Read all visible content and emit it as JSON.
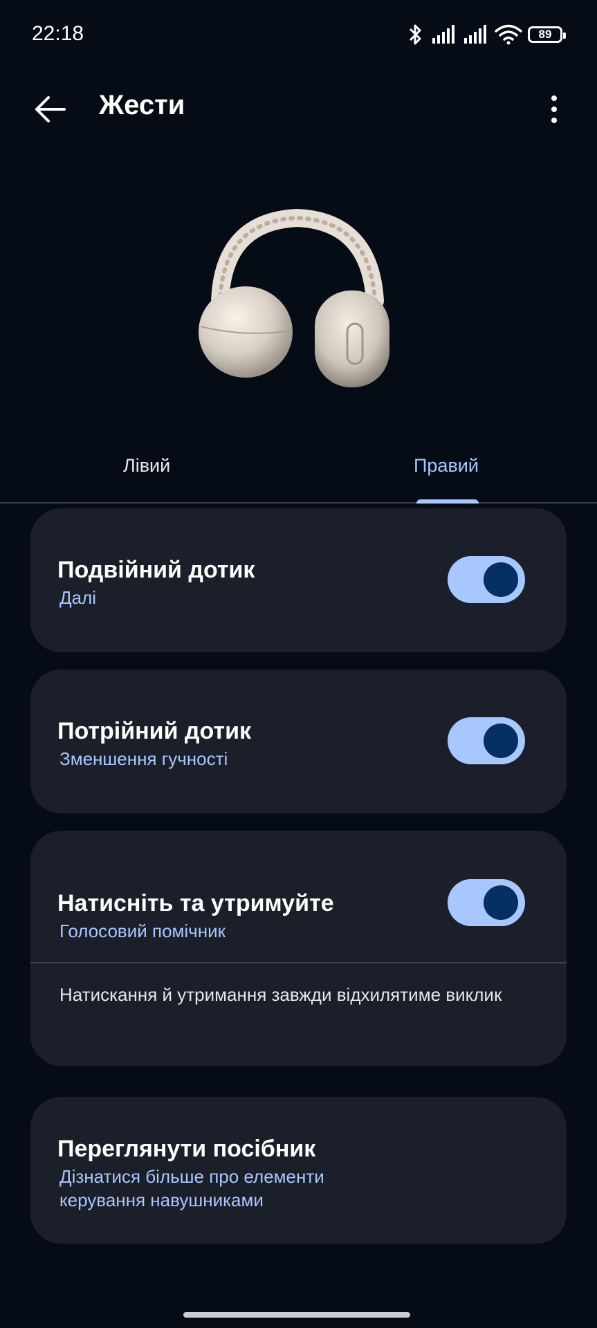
{
  "status_bar": {
    "time": "22:18",
    "battery_level": "89"
  },
  "app_bar": {
    "title": "Жести"
  },
  "tabs": {
    "left_label": "Лівий",
    "right_label": "Правий",
    "selected": "right"
  },
  "gestures": [
    {
      "title": "Подвійний дотик",
      "action": "Далі",
      "enabled": true
    },
    {
      "title": "Потрійний дотик",
      "action": "Зменшення гучності",
      "enabled": true
    },
    {
      "title": "Натисніть та утримуйте",
      "action": "Голосовий помічник",
      "enabled": true,
      "note": "Натискання й утримання завжди відхилятиме виклик"
    }
  ],
  "guide": {
    "title": "Переглянути посібник",
    "subtitle_line1": "Дізнатися більше про елементи",
    "subtitle_line2": "керування навушниками"
  },
  "colors": {
    "background": "#050c16",
    "card": "#1b1f29",
    "accent": "#a9c7ff",
    "toggle_knob": "#062f63"
  }
}
